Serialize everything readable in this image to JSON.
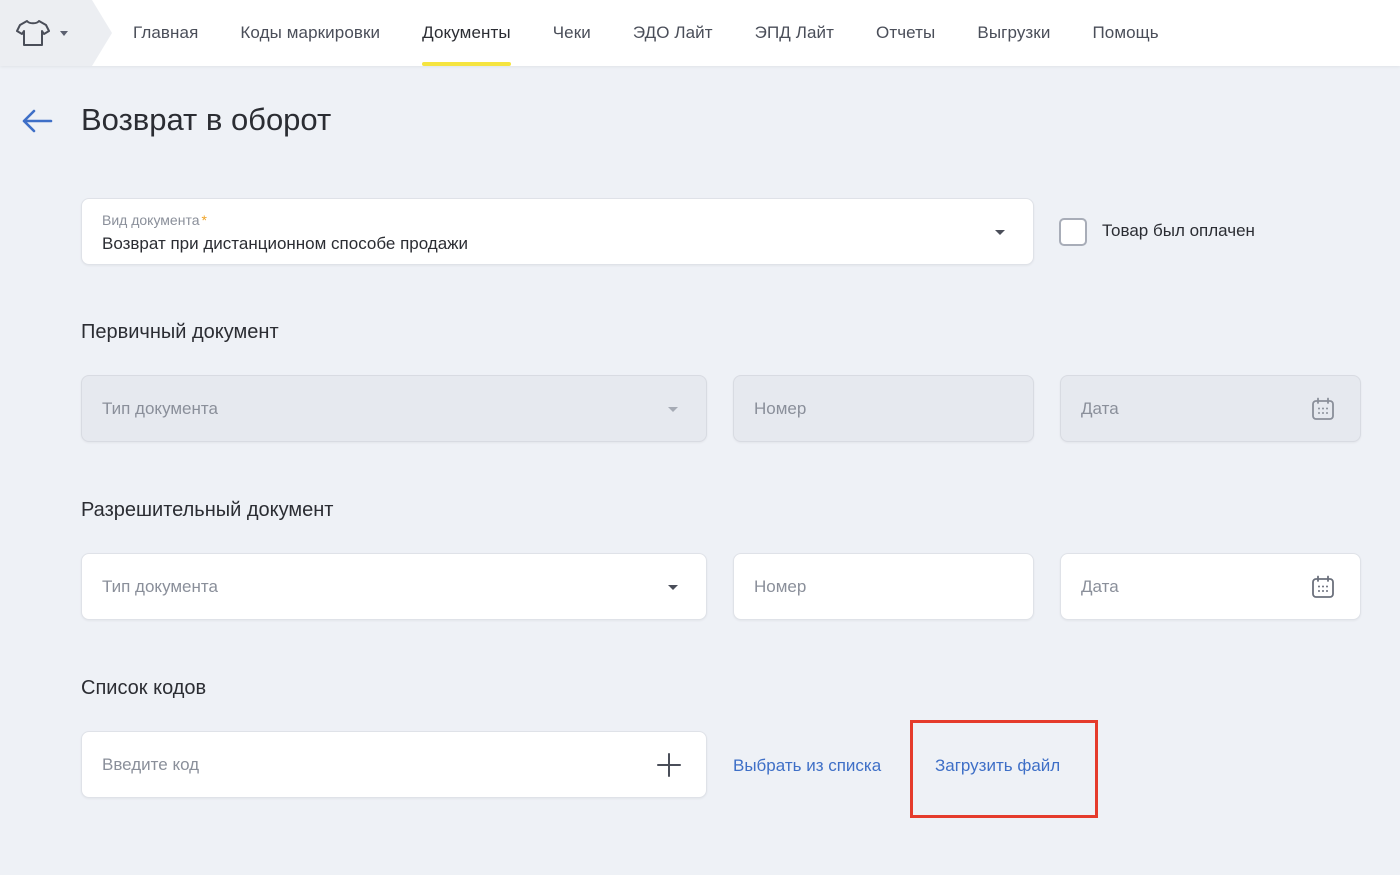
{
  "nav": {
    "items": [
      {
        "label": "Главная"
      },
      {
        "label": "Коды маркировки"
      },
      {
        "label": "Документы",
        "active": true
      },
      {
        "label": "Чеки"
      },
      {
        "label": "ЭДО Лайт"
      },
      {
        "label": "ЭПД Лайт"
      },
      {
        "label": "Отчеты"
      },
      {
        "label": "Выгрузки"
      },
      {
        "label": "Помощь"
      }
    ],
    "logo_icon": "tshirt-icon",
    "active_underline_color": "#f5e43f"
  },
  "header": {
    "title": "Возврат в оборот",
    "back_icon": "arrow-left-icon"
  },
  "doc_type": {
    "label": "Вид документа",
    "required_mark": "*",
    "value": "Возврат при дистанционном способе продажи"
  },
  "paid_checkbox": {
    "label": "Товар был оплачен",
    "checked": false
  },
  "primary_doc": {
    "title": "Первичный документ",
    "type_placeholder": "Тип документа",
    "number_placeholder": "Номер",
    "date_placeholder": "Дата",
    "disabled": true
  },
  "permit_doc": {
    "title": "Разрешительный документ",
    "type_placeholder": "Тип документа",
    "number_placeholder": "Номер",
    "date_placeholder": "Дата"
  },
  "codes": {
    "title": "Список кодов",
    "input_placeholder": "Введите код",
    "choose_from_list": "Выбрать из списка",
    "upload_file": "Загрузить файл"
  },
  "colors": {
    "link": "#3e6fc7",
    "highlight": "#e53b2c",
    "background": "#eef1f6"
  }
}
